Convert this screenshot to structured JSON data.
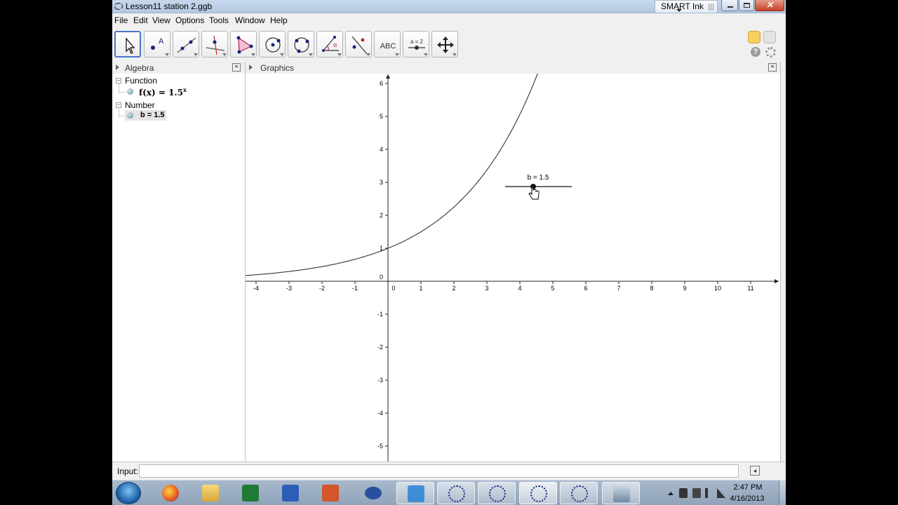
{
  "window": {
    "title": "Lesson11 station 2.ggb",
    "smart_ink": "SMART Ink"
  },
  "menu": [
    "File",
    "Edit",
    "View",
    "Options",
    "Tools",
    "Window",
    "Help"
  ],
  "toolbar": {
    "text_tool_label": "ABC",
    "slider_tool_label": "a = 2"
  },
  "algebra": {
    "title": "Algebra",
    "groups": [
      {
        "label": "Function",
        "item": "f(x) = 1.5",
        "exponent": "x"
      },
      {
        "label": "Number",
        "item": "b = 1.5"
      }
    ]
  },
  "graphics": {
    "title": "Graphics",
    "slider_label": "b = 1.5"
  },
  "input": {
    "label": "Input:",
    "value": ""
  },
  "taskbar": {
    "time": "2:47 PM",
    "date": "4/16/2013"
  },
  "chart_data": {
    "type": "line",
    "function": "f(x) = 1.5^x",
    "base": 1.5,
    "xlim": [
      -4.4,
      11.8
    ],
    "ylim": [
      -5.4,
      6.2
    ],
    "x_ticks": [
      -4,
      -3,
      -2,
      -1,
      0,
      1,
      2,
      3,
      4,
      5,
      6,
      7,
      8,
      9,
      10,
      11
    ],
    "y_ticks": [
      -5,
      -4,
      -3,
      -2,
      -1,
      0,
      1,
      2,
      3,
      4,
      5,
      6
    ],
    "grid": false,
    "slider": {
      "name": "b",
      "value": 1.5
    }
  }
}
